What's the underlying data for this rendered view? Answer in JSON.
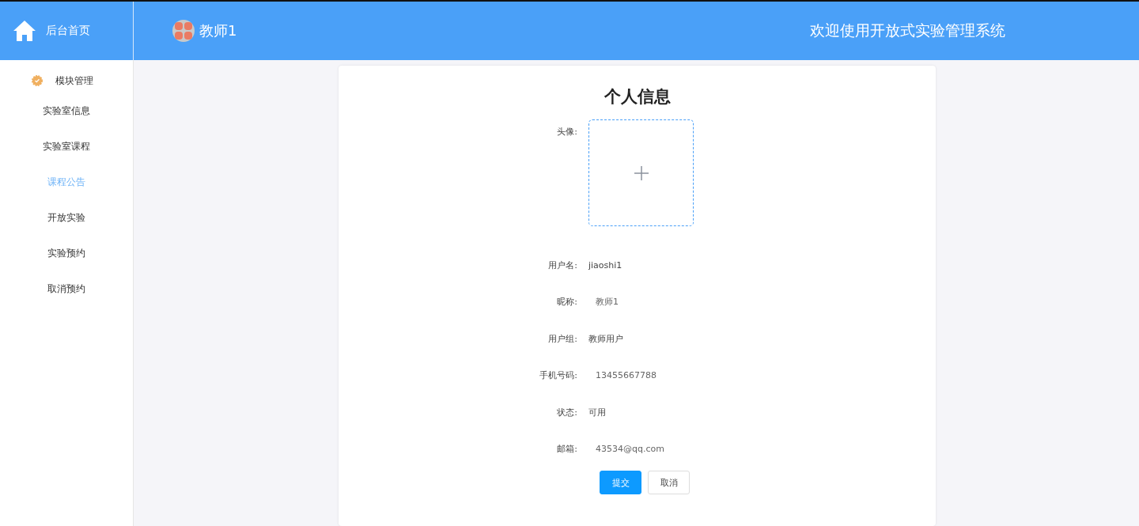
{
  "header": {
    "home_label": "后台首页",
    "user_name": "教师1",
    "welcome": "欢迎使用开放式实验管理系统"
  },
  "sidebar": {
    "group": "模块管理",
    "items": [
      {
        "label": "实验室信息",
        "selected": false
      },
      {
        "label": "实验室课程",
        "selected": false
      },
      {
        "label": "课程公告",
        "selected": true
      },
      {
        "label": "开放实验",
        "selected": false
      },
      {
        "label": "实验预约",
        "selected": false
      },
      {
        "label": "取消预约",
        "selected": false
      }
    ]
  },
  "form": {
    "title": "个人信息",
    "avatar_label": "头像:",
    "fields": [
      {
        "label": "用户名:",
        "value": "jiaoshi1",
        "kind": "text"
      },
      {
        "label": "昵称:",
        "value": "教师1",
        "kind": "input"
      },
      {
        "label": "用户组:",
        "value": "教师用户",
        "kind": "text"
      },
      {
        "label": "手机号码:",
        "value": "13455667788",
        "kind": "input"
      },
      {
        "label": "状态:",
        "value": "可用",
        "kind": "text"
      },
      {
        "label": "邮箱:",
        "value": "43534@qq.com",
        "kind": "input"
      }
    ],
    "buttons": {
      "submit": "提交",
      "cancel": "取消"
    }
  }
}
